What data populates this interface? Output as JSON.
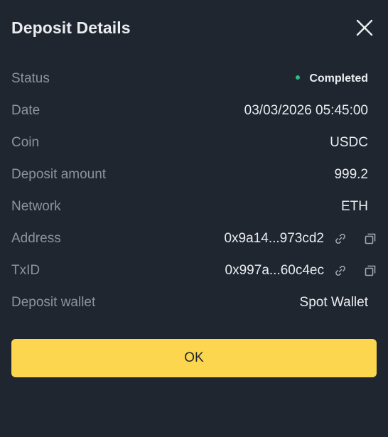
{
  "modal": {
    "title": "Deposit Details",
    "close_icon": "close-icon"
  },
  "details": {
    "status": {
      "label": "Status",
      "value": "Completed",
      "dot_color": "#2ebd85"
    },
    "date": {
      "label": "Date",
      "value": "03/03/2026 05:45:00"
    },
    "coin": {
      "label": "Coin",
      "value": "USDC"
    },
    "amount": {
      "label": "Deposit amount",
      "value": "999.2"
    },
    "network": {
      "label": "Network",
      "value": "ETH"
    },
    "address": {
      "label": "Address",
      "value": "0x9a14...973cd2",
      "icons": [
        "link-icon",
        "copy-icon"
      ]
    },
    "txid": {
      "label": "TxID",
      "value": "0x997a...60c4ec",
      "icons": [
        "link-icon",
        "copy-icon"
      ]
    },
    "wallet": {
      "label": "Deposit wallet",
      "value": "Spot Wallet"
    }
  },
  "actions": {
    "ok_label": "OK",
    "ok_color": "#fcd64f"
  },
  "colors": {
    "background": "#1f2630",
    "label": "#8b939e",
    "value": "#eaecef"
  }
}
